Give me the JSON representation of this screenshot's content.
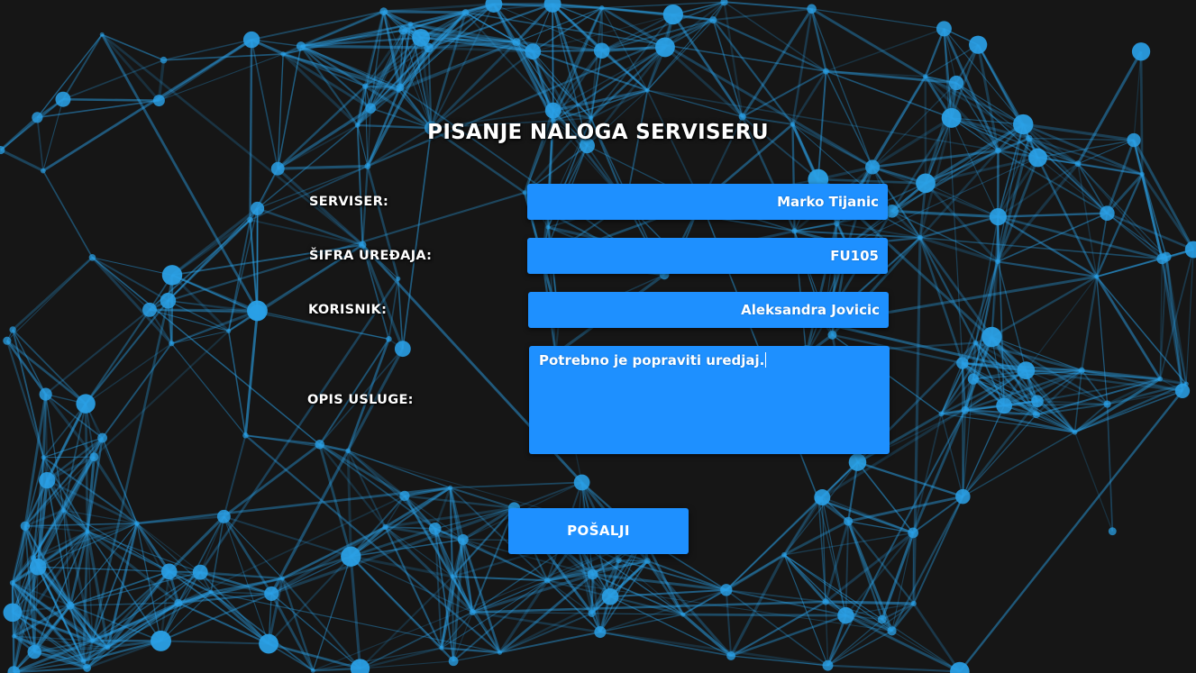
{
  "form": {
    "title": "PISANJE NALOGA SERVISERU",
    "fields": {
      "serviser": {
        "label": "SERVISER:",
        "value": "Marko Tijanic"
      },
      "sifra_uredjaja": {
        "label": "ŠIFRA UREĐAJA:",
        "value": "FU105"
      },
      "korisnik": {
        "label": "KORISNIK:",
        "value": "Aleksandra Jovicic"
      },
      "opis_usluge": {
        "label": "OPIS USLUGE:",
        "value": "Potrebno je popraviti uredjaj."
      }
    },
    "submit_label": "POŠALJI"
  },
  "colors": {
    "accent": "#1e90ff",
    "background": "#161616",
    "network": "#2aa0e6"
  }
}
